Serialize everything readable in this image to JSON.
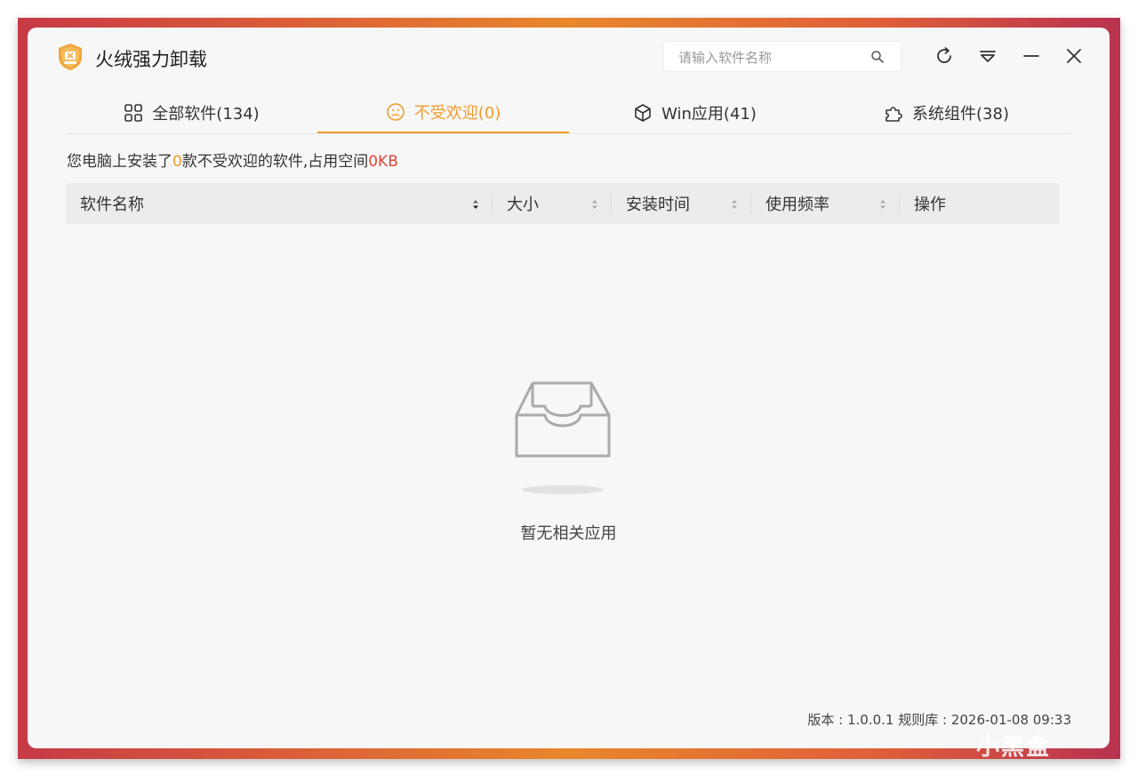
{
  "app": {
    "title": "火绒强力卸载"
  },
  "search": {
    "placeholder": "请输入软件名称",
    "value": ""
  },
  "tabs": [
    {
      "label": "全部软件(134)",
      "icon": "grid-icon",
      "active": false
    },
    {
      "label": "不受欢迎(0)",
      "icon": "frown-icon",
      "active": true
    },
    {
      "label": "Win应用(41)",
      "icon": "cube-icon",
      "active": false
    },
    {
      "label": "系统组件(38)",
      "icon": "puzzle-icon",
      "active": false
    }
  ],
  "summary": {
    "prefix": "您电脑上安装了",
    "count": "0",
    "middle": "款不受欢迎的软件,占用空间",
    "size": "0KB"
  },
  "table": {
    "columns": [
      "软件名称",
      "大小",
      "安装时间",
      "使用频率",
      "操作"
    ],
    "rows": []
  },
  "empty_state": {
    "text": "暂无相关应用"
  },
  "footer": {
    "text": "版本 : 1.0.0.1   规则库 : 2026-01-08 09:33"
  },
  "watermark": "小黑盒",
  "colors": {
    "accent": "#f29b2a",
    "danger": "#e0453a",
    "background": "#f7f7f7"
  }
}
